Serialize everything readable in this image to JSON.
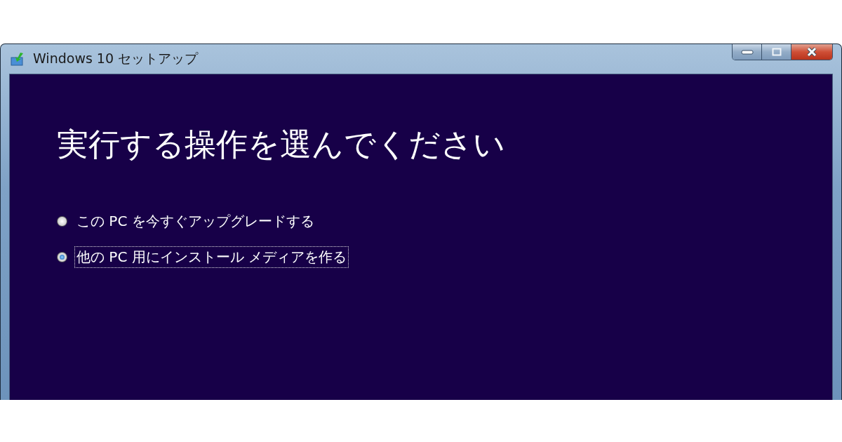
{
  "window": {
    "title": "Windows 10 セットアップ"
  },
  "heading": "実行する操作を選んでください",
  "options": [
    {
      "label": "この PC を今すぐアップグレードする",
      "selected": false
    },
    {
      "label": "他の PC 用にインストール メディアを作る",
      "selected": true
    }
  ]
}
